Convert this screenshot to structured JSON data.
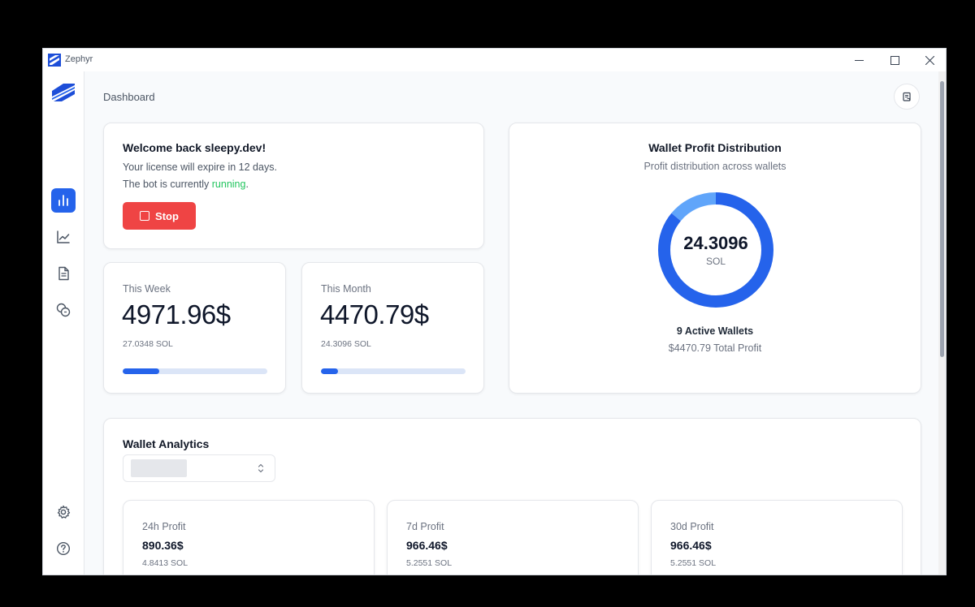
{
  "window": {
    "title": "Zephyr",
    "controls": {
      "minimize": "—",
      "maximize": "☐",
      "close": "✕"
    }
  },
  "sidebar": {
    "items": [
      {
        "name": "analytics",
        "icon": "bar-chart-icon",
        "active": true
      },
      {
        "name": "line-chart",
        "icon": "line-chart-icon",
        "active": false
      },
      {
        "name": "document",
        "icon": "document-icon",
        "active": false
      },
      {
        "name": "coins",
        "icon": "coins-icon",
        "active": false
      }
    ],
    "bottom": [
      {
        "name": "settings",
        "icon": "gear-icon"
      },
      {
        "name": "help",
        "icon": "help-icon"
      }
    ]
  },
  "header": {
    "breadcrumb": "Dashboard"
  },
  "welcome": {
    "title": "Welcome back sleepy.dev!",
    "license_text": "Your license will expire in 12 days.",
    "bot_status_prefix": "The bot is currently ",
    "bot_status": "running",
    "bot_status_suffix": ".",
    "stop_label": "Stop"
  },
  "stats": {
    "week": {
      "label": "This Week",
      "value": "4971.96$",
      "sol": "27.0348 SOL",
      "progress": 0.25
    },
    "month": {
      "label": "This Month",
      "value": "4470.79$",
      "sol": "24.3096 SOL",
      "progress": 0.12
    }
  },
  "distribution": {
    "title": "Wallet Profit Distribution",
    "subtitle": "Profit distribution across wallets",
    "center_value": "24.3096",
    "center_unit": "SOL",
    "active_wallets": "9 Active Wallets",
    "total_profit": "$4470.79 Total Profit",
    "segments": [
      {
        "fraction": 0.86,
        "color": "#2563eb"
      },
      {
        "fraction": 0.14,
        "color": "#60a5fa"
      }
    ]
  },
  "analytics": {
    "title": "Wallet Analytics",
    "cards": [
      {
        "label": "24h Profit",
        "value": "890.36$",
        "sol": "4.8413 SOL"
      },
      {
        "label": "7d Profit",
        "value": "966.46$",
        "sol": "5.2551 SOL"
      },
      {
        "label": "30d Profit",
        "value": "966.46$",
        "sol": "5.2551 SOL"
      }
    ]
  },
  "colors": {
    "accent": "#2563eb",
    "danger": "#ef4444",
    "success": "#22c55e"
  }
}
